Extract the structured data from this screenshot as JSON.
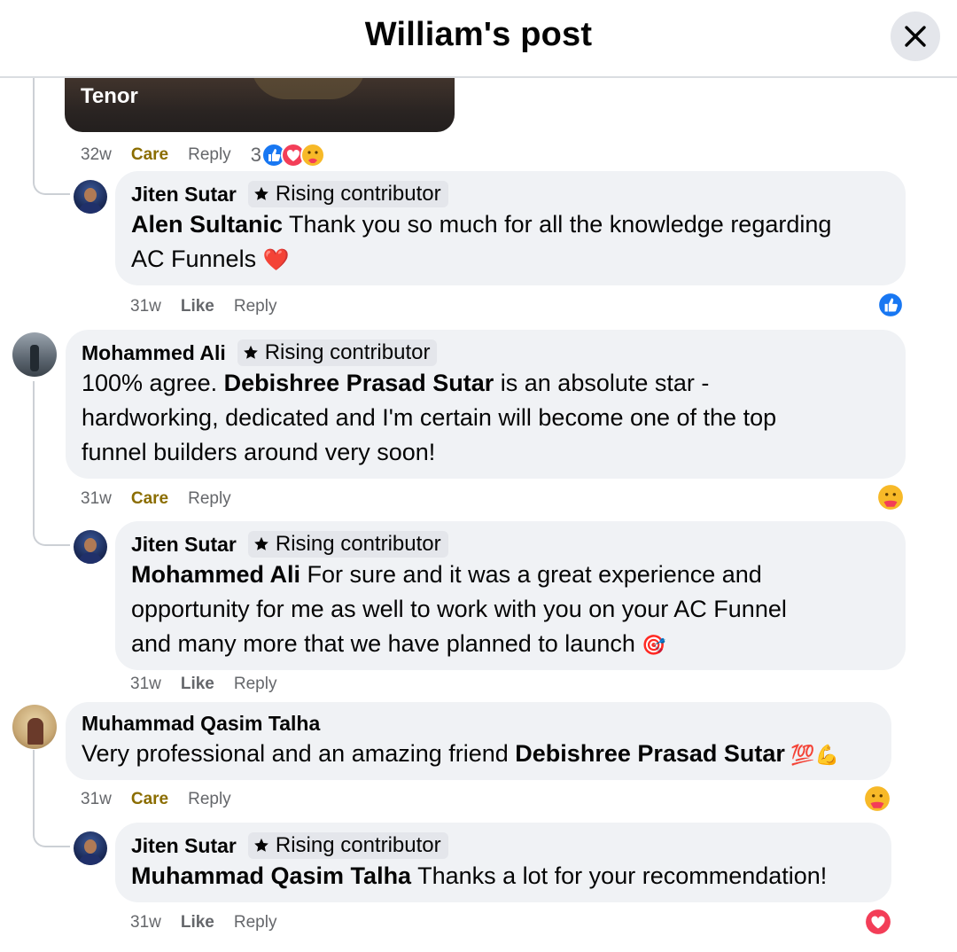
{
  "header": {
    "title": "William's post"
  },
  "gif": {
    "label": "Tenor"
  },
  "comment0": {
    "time": "32w",
    "reaction_label": "Care",
    "reply_label": "Reply",
    "reaction_count": "3"
  },
  "comments": [
    {
      "author": "Jiten Sutar",
      "badge": "Rising contributor",
      "mention": "Alen Sultanic",
      "text": " Thank you so much for all the knowledge regarding",
      "text_line2": "AC Funnels ",
      "emoji": "❤️",
      "time": "31w",
      "action": "Like",
      "reply": "Reply",
      "reaction_icon": "like-reaction-icon"
    },
    {
      "author": "Mohammed Ali",
      "badge": "Rising contributor",
      "text_before": "100% agree. ",
      "mention": "Debishree Prasad Sutar",
      "text_after": " is an absolute star -",
      "text_line2": "hardworking, dedicated and I'm certain will become one of the top",
      "text_line3": "funnel builders around very soon!",
      "time": "31w",
      "action": "Care",
      "reply": "Reply",
      "reaction_icon": "care-reaction-icon"
    },
    {
      "author": "Jiten Sutar",
      "badge": "Rising contributor",
      "mention": "Mohammed Ali",
      "text": " For sure and it was a great experience and",
      "text_line2": "opportunity for me as well to work with you on your AC Funnel",
      "text_line3": "and many more that we have planned to launch ",
      "emoji": "🎯",
      "time": "31w",
      "action": "Like",
      "reply": "Reply"
    },
    {
      "author": "Muhammad Qasim Talha",
      "text_before": "Very professional and an amazing friend ",
      "mention": "Debishree Prasad Sutar",
      "emoji": " 💯💪",
      "time": "31w",
      "action": "Care",
      "reply": "Reply",
      "reaction_icon": "care-reaction-icon"
    },
    {
      "author": "Jiten Sutar",
      "badge": "Rising contributor",
      "mention": "Muhammad Qasim Talha",
      "text": " Thanks a lot for your recommendation!",
      "time": "31w",
      "action": "Like",
      "reply": "Reply",
      "reaction_icon": "love-reaction-icon"
    }
  ],
  "colors": {
    "like_blue": "#1877f2",
    "love_red": "#f33e58",
    "care_yellow": "#f7b928",
    "care_text": "#8b6d00"
  }
}
